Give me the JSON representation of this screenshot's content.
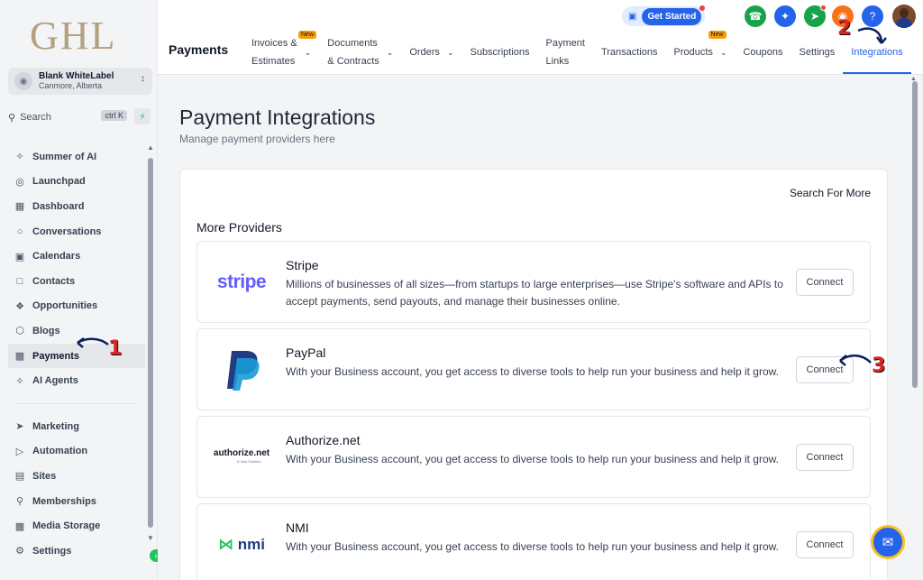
{
  "sidebar": {
    "logo": "GHL",
    "account": {
      "name": "Blank WhiteLabel",
      "location": "Canmore, Alberta"
    },
    "search": {
      "label": "Search",
      "shortcut": "ctrl K"
    },
    "items": [
      {
        "label": "Summer of AI",
        "icon": "sparkle-icon"
      },
      {
        "label": "Launchpad",
        "icon": "rocket-icon"
      },
      {
        "label": "Dashboard",
        "icon": "grid-icon"
      },
      {
        "label": "Conversations",
        "icon": "chat-icon"
      },
      {
        "label": "Calendars",
        "icon": "calendar-icon"
      },
      {
        "label": "Contacts",
        "icon": "contacts-icon"
      },
      {
        "label": "Opportunities",
        "icon": "funnel-icon"
      },
      {
        "label": "Blogs",
        "icon": "box-icon"
      },
      {
        "label": "Payments",
        "icon": "receipt-icon"
      },
      {
        "label": "AI Agents",
        "icon": "sparkle-icon"
      }
    ],
    "items_secondary": [
      {
        "label": "Marketing",
        "icon": "send-icon"
      },
      {
        "label": "Automation",
        "icon": "automation-icon"
      },
      {
        "label": "Sites",
        "icon": "sites-icon"
      },
      {
        "label": "Memberships",
        "icon": "membership-icon"
      },
      {
        "label": "Media Storage",
        "icon": "image-icon"
      },
      {
        "label": "Settings",
        "icon": "gear-icon"
      }
    ]
  },
  "header": {
    "get_started": "Get Started",
    "page_title": "Payments",
    "tabs": [
      {
        "line1": "Invoices &",
        "line2": "Estimates",
        "badge": "New"
      },
      {
        "line1": "Documents",
        "line2": "& Contracts"
      },
      {
        "label": "Orders"
      },
      {
        "label": "Subscriptions"
      },
      {
        "line1": "Payment",
        "line2": "Links"
      },
      {
        "label": "Transactions"
      },
      {
        "label": "Products",
        "badge": "New"
      },
      {
        "label": "Coupons"
      },
      {
        "label": "Settings"
      },
      {
        "label": "Integrations"
      }
    ],
    "icon_colors": {
      "phone": "#16a34a",
      "magic": "#2563eb",
      "megaphone": "#16a34a",
      "help": "#2563eb",
      "bell": "#f97316"
    }
  },
  "main": {
    "title": "Payment Integrations",
    "subtitle": "Manage payment providers here",
    "search_more": "Search For More",
    "section_title": "More Providers",
    "providers": [
      {
        "name": "Stripe",
        "logo_text": "stripe",
        "description": "Millions of businesses of all sizes—from startups to large enterprises—use Stripe's software and APIs to accept payments, send payouts, and manage their businesses online.",
        "button": "Connect"
      },
      {
        "name": "PayPal",
        "logo_text": "",
        "description": "With your Business account, you get access to diverse tools to help run your business and help it grow.",
        "button": "Connect"
      },
      {
        "name": "Authorize.net",
        "logo_text": "authorize.net",
        "logo_sub": "A Visa Solution",
        "description": "With your Business account, you get access to diverse tools to help run your business and help it grow.",
        "button": "Connect"
      },
      {
        "name": "NMI",
        "logo_text": "nmi",
        "description": "With your Business account, you get access to diverse tools to help run your business and help it grow.",
        "button": "Connect"
      }
    ]
  },
  "annotations": {
    "step1": "1",
    "step2": "2",
    "step3": "3"
  }
}
